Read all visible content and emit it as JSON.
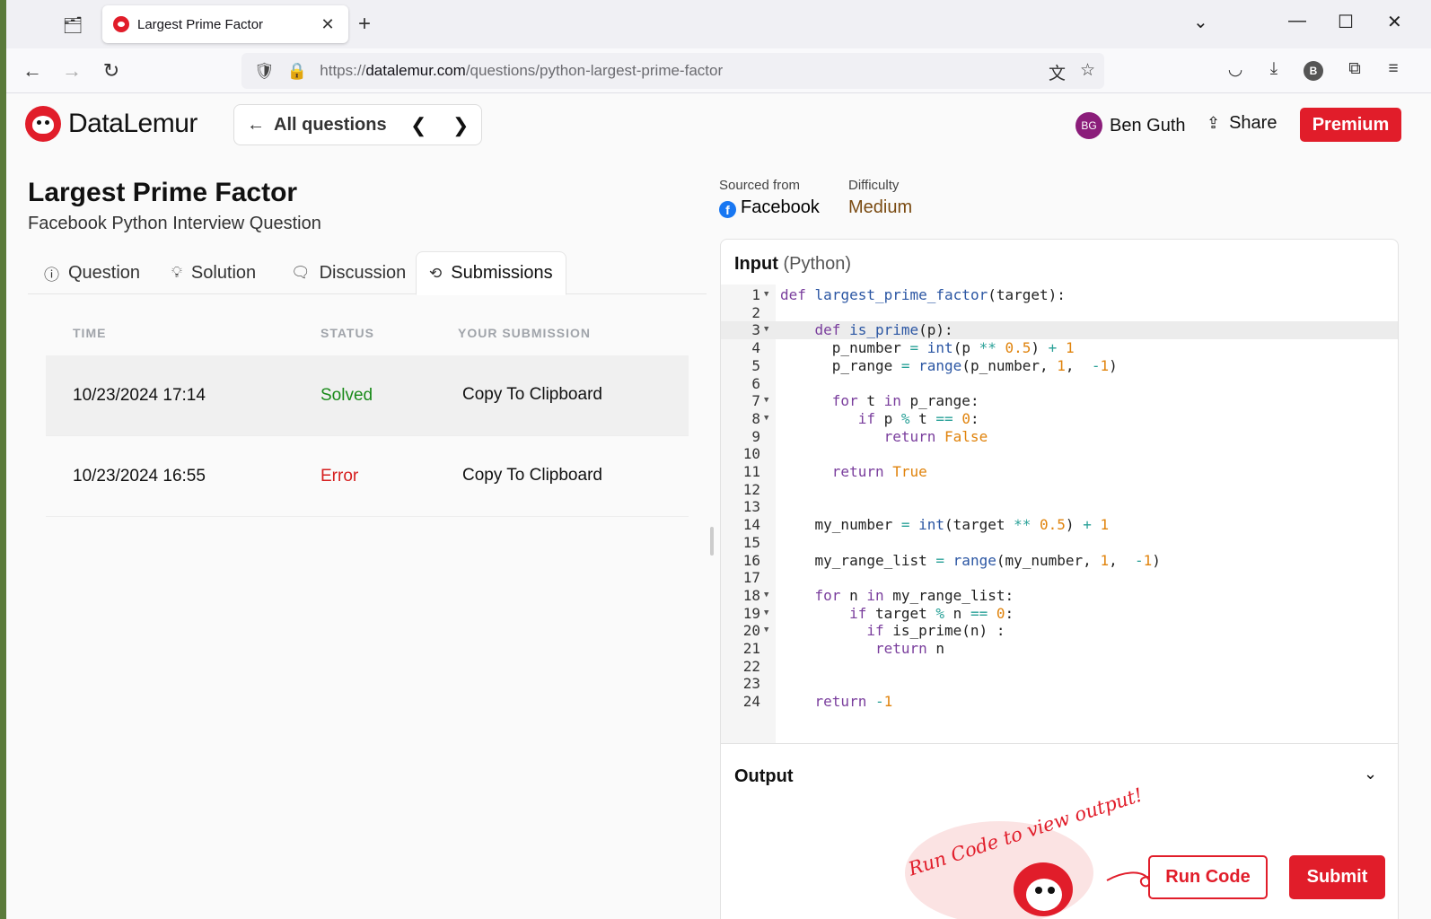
{
  "browser": {
    "tab_title": "Largest Prime Factor",
    "url_prefix": "https://",
    "url_host": "datalemur.com",
    "url_path": "/questions/python-largest-prime-factor",
    "profile_initial": "B"
  },
  "header": {
    "logo_text": "DataLemur",
    "all_questions": "All questions",
    "user_initials": "BG",
    "user_name": "Ben Guth",
    "share_label": "Share",
    "premium_label": "Premium"
  },
  "question": {
    "title": "Largest Prime Factor",
    "subtitle": "Facebook Python Interview Question",
    "sourced_label": "Sourced from",
    "source": "Facebook",
    "difficulty_label": "Difficulty",
    "difficulty": "Medium"
  },
  "tabs": [
    {
      "label": "Question",
      "icon": "question-circle-icon"
    },
    {
      "label": "Solution",
      "icon": "lightbulb-icon"
    },
    {
      "label": "Discussion",
      "icon": "chat-bubbles-icon"
    },
    {
      "label": "Submissions",
      "icon": "history-icon",
      "active": true
    }
  ],
  "submissions": {
    "headers": [
      "TIME",
      "STATUS",
      "YOUR SUBMISSION"
    ],
    "rows": [
      {
        "time": "10/23/2024 17:14",
        "status": "Solved",
        "action": "Copy To Clipboard"
      },
      {
        "time": "10/23/2024 16:55",
        "status": "Error",
        "action": "Copy To Clipboard"
      }
    ]
  },
  "editor": {
    "title": "Input",
    "language": "(Python)",
    "lines": [
      "def largest_prime_factor(target):",
      "",
      "    def is_prime(p):",
      "      p_number = int(p ** 0.5) + 1",
      "      p_range = range(p_number, 1,  -1)",
      "",
      "      for t in p_range:",
      "         if p % t == 0:",
      "            return False",
      "",
      "      return True",
      "",
      "",
      "    my_number = int(target ** 0.5) + 1",
      "",
      "    my_range_list = range(my_number, 1,  -1)",
      "",
      "    for n in my_range_list:",
      "        if target % n == 0:",
      "          if is_prime(n) :",
      "           return n",
      "",
      "",
      "    return -1"
    ],
    "folds": [
      1,
      3,
      7,
      8,
      18,
      19,
      20
    ],
    "active_line": 3
  },
  "output": {
    "label": "Output",
    "hint": "Run Code to view output!",
    "run_label": "Run Code",
    "submit_label": "Submit"
  },
  "colors": {
    "brand_red": "#e11d2a",
    "solved_green": "#1a8a1a",
    "difficulty_brown": "#7a4b12"
  }
}
